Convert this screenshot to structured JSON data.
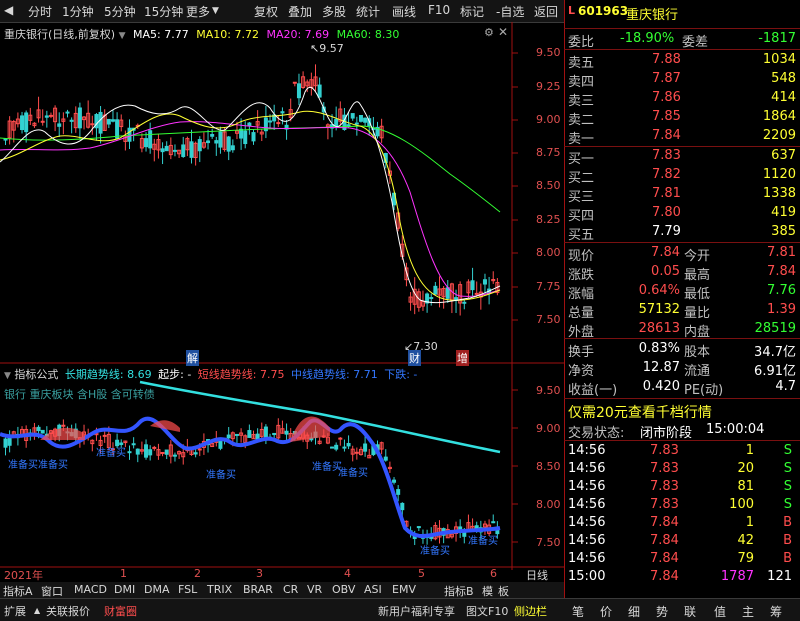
{
  "toolbar": {
    "tabs": [
      "分时",
      "1分钟",
      "5分钟",
      "15分钟",
      "更多"
    ],
    "right_tabs": [
      "复权",
      "叠加",
      "多股",
      "统计",
      "画线",
      "F10",
      "标记",
      "-自选",
      "返回"
    ]
  },
  "main_header": {
    "stock": "重庆银行(日线,前复权)",
    "ma5": "MA5: 7.77",
    "ma10": "MA10: 7.72",
    "ma20": "MA20: 7.69",
    "ma60": "MA60: 8.30"
  },
  "price_axis": [
    "9.50",
    "9.25",
    "9.00",
    "8.75",
    "8.50",
    "8.25",
    "8.00",
    "7.75",
    "7.50"
  ],
  "annotations": {
    "high": "9.57",
    "low": "7.30",
    "m1": "解",
    "m2": "财",
    "m3": "增"
  },
  "ind_header": {
    "name": "指标公式",
    "long": "长期趋势线: 8.69",
    "start": "起步: -",
    "short": "短线趋势线: 7.75",
    "mid": "中线趋势线: 7.71",
    "down": "下跌: -"
  },
  "ind_sub": "银行 重庆板块 含H股 含可转债",
  "ind_axis": [
    "9.50",
    "9.00",
    "8.50",
    "8.00",
    "7.50"
  ],
  "ind_labels": [
    "准备买",
    "准备买",
    "准备买",
    "准备买",
    "准备买",
    "准备买",
    "准备买",
    "准备买"
  ],
  "time_axis": {
    "year": "2021年",
    "months": [
      "1",
      "2",
      "3",
      "4",
      "5",
      "6"
    ],
    "period": "日线"
  },
  "indicator_tabs": [
    "指标A",
    "窗口",
    "MACD",
    "DMI",
    "DMA",
    "FSL",
    "TRIX",
    "BRAR",
    "CR",
    "VR",
    "OBV",
    "ASI",
    "EMV",
    "指标B",
    "模",
    "板"
  ],
  "quote": {
    "code": "601963",
    "name": "重庆银行",
    "weibi_label": "委比",
    "weibi": "-18.90%",
    "weicha_label": "委差",
    "weicha": "-1817",
    "asks": [
      {
        "label": "卖五",
        "price": "7.88",
        "vol": "1034"
      },
      {
        "label": "卖四",
        "price": "7.87",
        "vol": "548"
      },
      {
        "label": "卖三",
        "price": "7.86",
        "vol": "414"
      },
      {
        "label": "卖二",
        "price": "7.85",
        "vol": "1864"
      },
      {
        "label": "卖一",
        "price": "7.84",
        "vol": "2209"
      }
    ],
    "bids": [
      {
        "label": "买一",
        "price": "7.83",
        "vol": "637"
      },
      {
        "label": "买二",
        "price": "7.82",
        "vol": "1120"
      },
      {
        "label": "买三",
        "price": "7.81",
        "vol": "1338"
      },
      {
        "label": "买四",
        "price": "7.80",
        "vol": "419"
      },
      {
        "label": "买五",
        "price": "7.79",
        "vol": "385"
      }
    ],
    "stats": [
      {
        "l1": "现价",
        "v1": "7.84",
        "l2": "今开",
        "v2": "7.81"
      },
      {
        "l1": "涨跌",
        "v1": "0.05",
        "l2": "最高",
        "v2": "7.84"
      },
      {
        "l1": "涨幅",
        "v1": "0.64%",
        "l2": "最低",
        "v2": "7.76"
      },
      {
        "l1": "总量",
        "v1": "57132",
        "l2": "量比",
        "v2": "1.39"
      },
      {
        "l1": "外盘",
        "v1": "28613",
        "l2": "内盘",
        "v2": "28519"
      }
    ],
    "stats2": [
      {
        "l1": "换手",
        "v1": "0.83%",
        "l2": "股本",
        "v2": "34.7亿"
      },
      {
        "l1": "净资",
        "v1": "12.87",
        "l2": "流通",
        "v2": "6.91亿"
      },
      {
        "l1": "收益(一)",
        "v1": "0.420",
        "l2": "PE(动)",
        "v2": "4.7"
      }
    ],
    "promo": "仅需20元查看千档行情",
    "trade_status_label": "交易状态:",
    "trade_status": "闭市阶段",
    "trade_time": "15:00:04",
    "ticks": [
      {
        "t": "14:56",
        "p": "7.83",
        "v": "1",
        "s": "S"
      },
      {
        "t": "14:56",
        "p": "7.83",
        "v": "20",
        "s": "S"
      },
      {
        "t": "14:56",
        "p": "7.83",
        "v": "81",
        "s": "S"
      },
      {
        "t": "14:56",
        "p": "7.83",
        "v": "100",
        "s": "S"
      },
      {
        "t": "14:56",
        "p": "7.84",
        "v": "1",
        "s": "B"
      },
      {
        "t": "14:56",
        "p": "7.84",
        "v": "42",
        "s": "B"
      },
      {
        "t": "14:56",
        "p": "7.84",
        "v": "79",
        "s": "B"
      },
      {
        "t": "15:00",
        "p": "7.84",
        "v": "1787",
        "s": "121"
      }
    ]
  },
  "bottom": {
    "left": [
      "扩展",
      "关联报价",
      "财富圈"
    ],
    "mid": [
      "新用户福利专享",
      "图文F10",
      "侧边栏"
    ],
    "right": [
      "笔",
      "价",
      "细",
      "势",
      "联",
      "值",
      "主",
      "筹"
    ]
  },
  "colors": {
    "up": "#ff4d4d",
    "down": "#33ff33",
    "ma5": "#ffffff",
    "ma10": "#ffff33",
    "ma20": "#ff33ff",
    "ma60": "#33ff33",
    "long": "#33e0e0",
    "short": "#ff4d4d",
    "mid": "#3355ff"
  }
}
